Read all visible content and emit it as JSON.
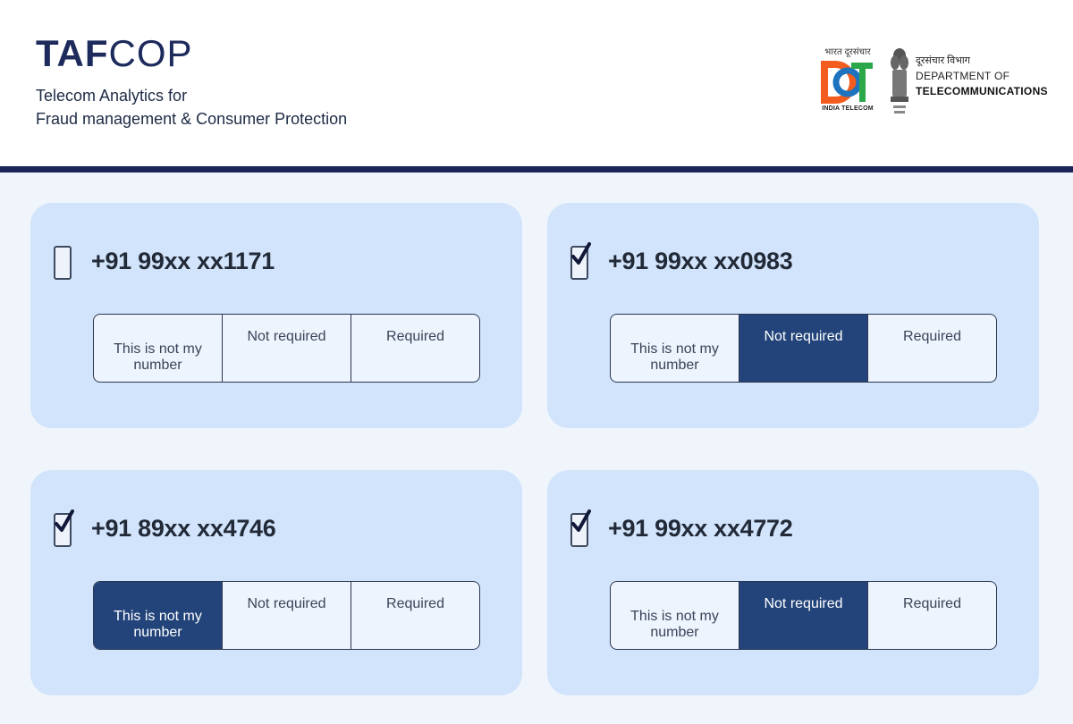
{
  "header": {
    "logo_bold": "TAF",
    "logo_light": "COP",
    "tagline_line1": "Telecom Analytics for",
    "tagline_line2": "Fraud management & Consumer Protection",
    "dot_hindi": "भारत दूरसंचार",
    "dot_caption": "INDIA TELECOM",
    "dept_hindi": "दूरसंचार विभाग",
    "dept_line1": "DEPARTMENT OF",
    "dept_line2": "TELECOMMUNICATIONS"
  },
  "option_labels": [
    "This is not my number",
    "Not required",
    "Required"
  ],
  "numbers": [
    {
      "phone": "+91 99xx xx1171",
      "checked": false,
      "selected": null
    },
    {
      "phone": "+91 99xx xx0983",
      "checked": true,
      "selected": 1
    },
    {
      "phone": "+91 89xx xx4746",
      "checked": true,
      "selected": 0
    },
    {
      "phone": "+91 99xx xx4772",
      "checked": true,
      "selected": 1
    }
  ],
  "colors": {
    "accent_dark_blue": "#23447a",
    "card_bg": "#d2e4fb",
    "header_rule": "#1b2557",
    "dot_orange": "#f25c1e",
    "dot_blue": "#1e73be",
    "dot_green": "#2aa84a"
  }
}
